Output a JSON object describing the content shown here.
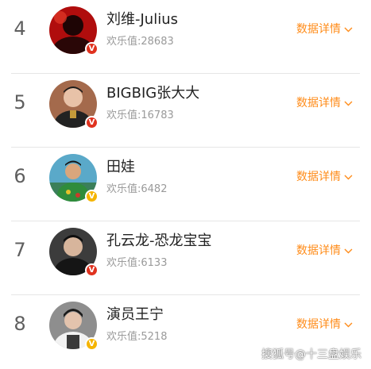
{
  "detail_label": "数据详情",
  "rows": [
    {
      "rank": "4",
      "name": "刘维-Julius",
      "score": "欢乐值:28683",
      "badge": "V",
      "badge_color": "#e0321f"
    },
    {
      "rank": "5",
      "name": "BIGBIG张大大",
      "score": "欢乐值:16783",
      "badge": "V",
      "badge_color": "#e0321f"
    },
    {
      "rank": "6",
      "name": "田娃",
      "score": "欢乐值:6482",
      "badge": "V",
      "badge_color": "#f5b400"
    },
    {
      "rank": "7",
      "name": "孔云龙-恐龙宝宝",
      "score": "欢乐值:6133",
      "badge": "V",
      "badge_color": "#e0321f"
    },
    {
      "rank": "8",
      "name": "演员王宁",
      "score": "欢乐值:5218",
      "badge": "V",
      "badge_color": "#f5b400"
    }
  ],
  "watermark": "搜狐号@十三盘娱乐",
  "colors": {
    "accent": "#ff8c1a",
    "rank": "#5f5f5f",
    "divider": "#e6e6e6"
  }
}
